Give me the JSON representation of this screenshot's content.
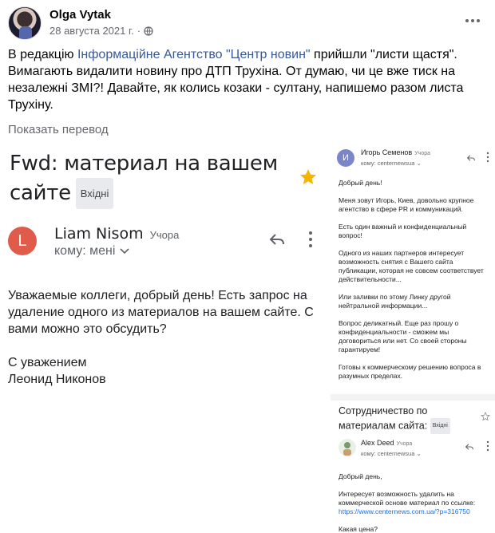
{
  "post": {
    "author": "Olga Vytak",
    "date": "28 августа 2021 г.",
    "separator": "·",
    "text_before_link": "В редакцію ",
    "link_text": "Інформаційне Агентство \"Центр новин\"",
    "text_after_link": "  прийшли \"листи щастя\". Вимагають видалити новину про ДТП Трухіна. От думаю, чи це вже тиск на незалежні ЗМІ?! Давайте, як колись козаки - султану, напишемо разом листа Трухіну.",
    "translate_label": "Показать перевод"
  },
  "mail_left": {
    "subject": "Fwd: материал на вашем сайте",
    "label_chip": "Вхідні",
    "avatar_letter": "L",
    "sender_name": "Liam Nisom",
    "time": "Учора",
    "recipient": "кому: мені",
    "body": [
      "Уважаемые коллеги, добрый день! Есть запрос на удаление одного из материалов на вашем сайте. С вами можно это обсудить?",
      "С уважением\nЛеонид Никонов"
    ]
  },
  "mail_right_top": {
    "avatar_letter": "И",
    "sender_name": "Игорь Семенов",
    "time": "Учора",
    "recipient": "кому: centernewsua",
    "body": [
      "Добрый день!",
      "Меня зовут Игорь, Киев, довольно крупное агентство в сфере PR и коммуникаций.",
      "Есть один важный и конфиденциальный вопрос!",
      "Одного из наших партнеров интересует возможность снятия с Вашего сайта публикации, которая не совсем соответствует действительности...",
      "Или заливки по этому Линку другой нейтральной информации...",
      "Вопрос деликатный. Еще раз прошу о конфиденциальности - сможем мы договориться или нет. Со своей стороны гарантируем!",
      "Готовы к коммерческому решению вопроса в разумных пределах."
    ]
  },
  "mail_right_bottom": {
    "subject": "Сотрудничество по материалам сайта:",
    "label_chip": "Вхідні",
    "sender_name": "Alex Deed",
    "time": "Учора",
    "recipient": "кому: centernewsua",
    "greeting": "Добрый день,",
    "body_text": "Интересует возможность удалить на коммерческой основе материал по ссылке:",
    "link": "https://www.centernews.com.ua/?p=316750",
    "question": "Какая цена?"
  },
  "colors": {
    "fb_link": "#385898",
    "gmail_avatar_red": "#e15b4a",
    "gmail_link": "#1a73e8",
    "star_yellow": "#f4b400"
  }
}
